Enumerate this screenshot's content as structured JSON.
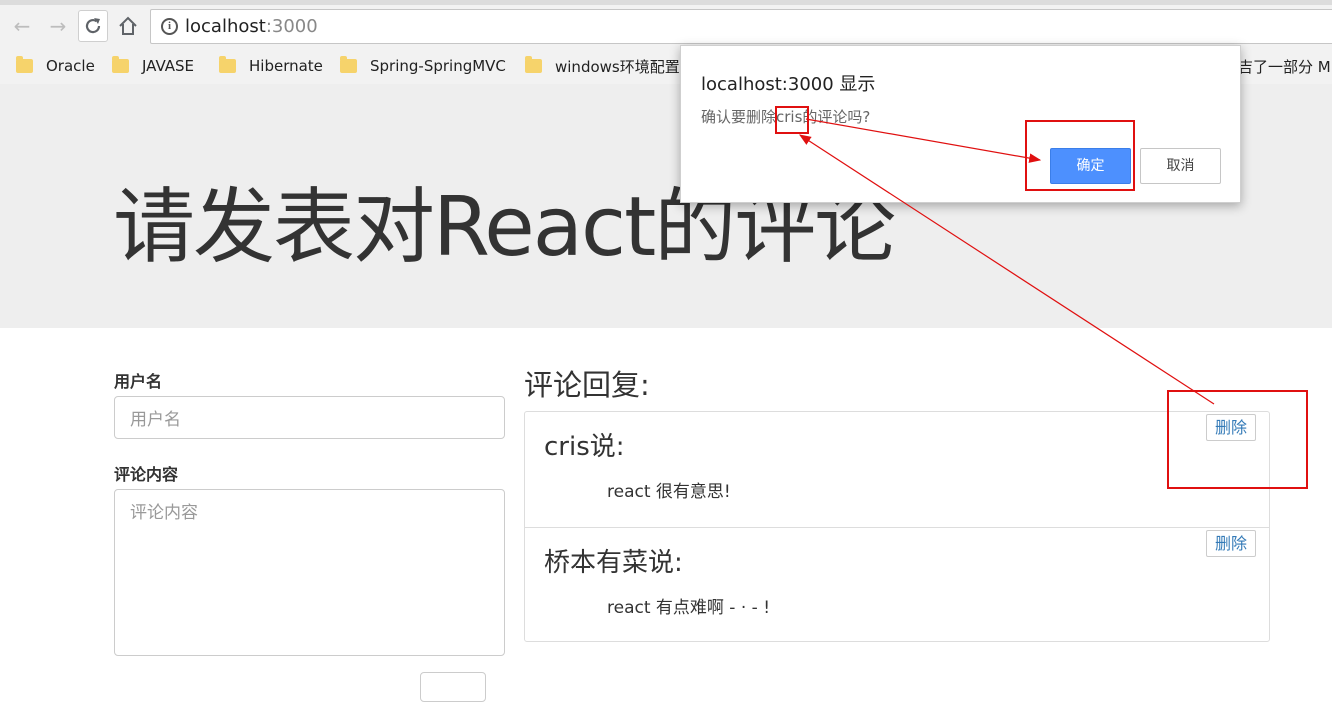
{
  "browser": {
    "url_host": "localhost",
    "url_port": ":3000",
    "bookmarks": [
      "Oracle",
      "JAVASE",
      "Hibernate",
      "Spring-SpringMVC",
      "windows环境配置",
      "吉了一部分 M"
    ]
  },
  "page": {
    "heading": "请发表对React的评论",
    "form": {
      "username_label": "用户名",
      "username_placeholder": "用户名",
      "content_label": "评论内容",
      "content_placeholder": "评论内容"
    },
    "comments_title": "评论回复:",
    "comments": [
      {
        "author_line": "cris说:",
        "text": "react 很有意思!",
        "delete_label": "删除"
      },
      {
        "author_line": "桥本有菜说:",
        "text": "react 有点难啊 - · - !",
        "delete_label": "删除"
      }
    ]
  },
  "dialog": {
    "title": "localhost:3000 显示",
    "message": "确认要删除cris的评论吗?",
    "ok_label": "确定",
    "cancel_label": "取消"
  },
  "colors": {
    "annotation": "#e01010",
    "primary_button": "#4d90fe",
    "link": "#337ab7"
  }
}
